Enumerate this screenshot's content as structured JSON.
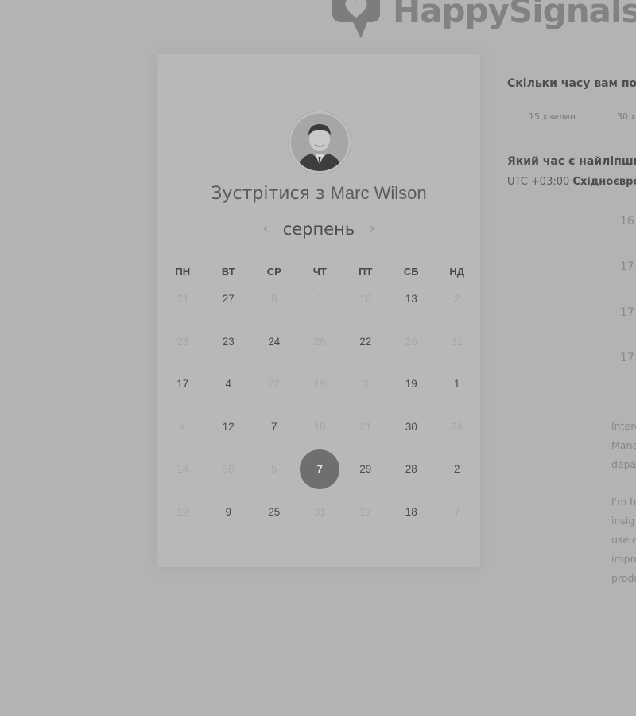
{
  "brand": {
    "name": "HappySignals",
    "logo_color": "#7d7d7d"
  },
  "card": {
    "title_prefix": "Зустрітися з",
    "host_name": "Marc Wilson",
    "month": "серпень",
    "prev_icon": "chevron-left-icon",
    "next_icon": "chevron-right-icon",
    "weekdays": [
      "ПН",
      "ВТ",
      "СР",
      "ЧТ",
      "ПТ",
      "СБ",
      "НД"
    ],
    "weeks": [
      [
        {
          "d": "21",
          "a": false
        },
        {
          "d": "27",
          "a": true
        },
        {
          "d": "8",
          "a": false
        },
        {
          "d": "1",
          "a": false
        },
        {
          "d": "16",
          "a": false
        },
        {
          "d": "13",
          "a": true
        },
        {
          "d": "2",
          "a": false
        }
      ],
      [
        {
          "d": "28",
          "a": false
        },
        {
          "d": "23",
          "a": true
        },
        {
          "d": "24",
          "a": true
        },
        {
          "d": "28",
          "a": false
        },
        {
          "d": "22",
          "a": true
        },
        {
          "d": "26",
          "a": false
        },
        {
          "d": "31",
          "a": false
        }
      ],
      [
        {
          "d": "17",
          "a": true
        },
        {
          "d": "4",
          "a": true
        },
        {
          "d": "22",
          "a": false
        },
        {
          "d": "19",
          "a": false
        },
        {
          "d": "3",
          "a": false
        },
        {
          "d": "19",
          "a": true
        },
        {
          "d": "1",
          "a": true
        }
      ],
      [
        {
          "d": "4",
          "a": false
        },
        {
          "d": "12",
          "a": true
        },
        {
          "d": "7",
          "a": true
        },
        {
          "d": "10",
          "a": false
        },
        {
          "d": "21",
          "a": false
        },
        {
          "d": "30",
          "a": true
        },
        {
          "d": "24",
          "a": false
        }
      ],
      [
        {
          "d": "14",
          "a": false
        },
        {
          "d": "30",
          "a": false
        },
        {
          "d": "5",
          "a": false
        },
        {
          "d": "7",
          "a": true,
          "s": true
        },
        {
          "d": "29",
          "a": true
        },
        {
          "d": "28",
          "a": true
        },
        {
          "d": "2",
          "a": true
        }
      ],
      [
        {
          "d": "12",
          "a": false
        },
        {
          "d": "9",
          "a": true
        },
        {
          "d": "25",
          "a": true
        },
        {
          "d": "31",
          "a": false
        },
        {
          "d": "17",
          "a": false
        },
        {
          "d": "18",
          "a": true
        },
        {
          "d": "7",
          "a": false
        }
      ]
    ],
    "selected_color": "#6f6f6f"
  },
  "panel": {
    "duration_question": "Скільки часу вам по",
    "durations": [
      "15 хвилин",
      "30 х"
    ],
    "time_question": "Який час є найліпши",
    "timezone_offset": "UTC +03:00",
    "timezone_name": "Східноєвро",
    "slots": [
      "16",
      "17",
      "17",
      "17"
    ],
    "description_1": [
      "Intere",
      "Mana",
      "depa"
    ],
    "description_2": [
      "I'm h",
      "insig",
      "use c",
      "impro",
      "produ"
    ]
  }
}
